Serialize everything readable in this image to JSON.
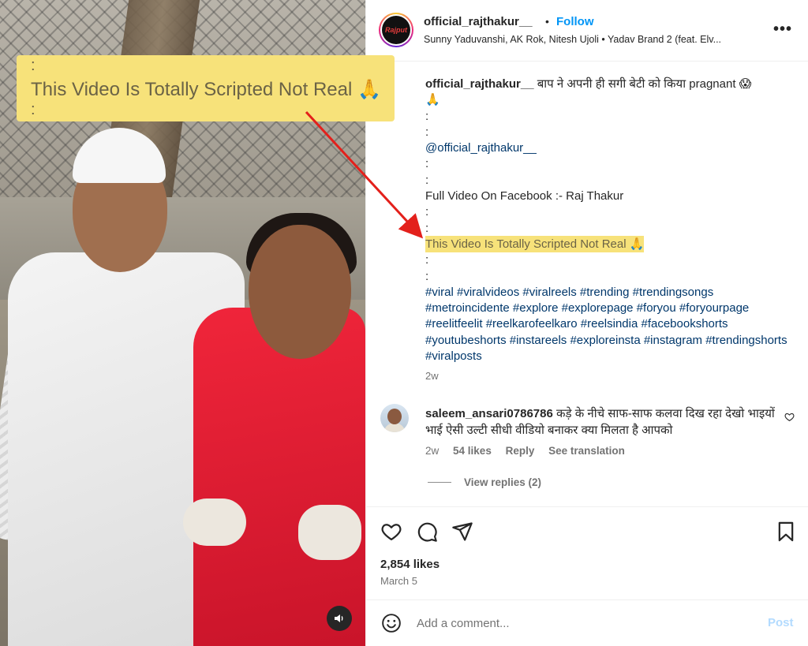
{
  "overlay": {
    "dot_top": ":",
    "text": "This Video Is Totally Scripted Not Real 🙏",
    "dot_bottom": ":"
  },
  "header": {
    "username": "official_rajthakur__",
    "separator": "•",
    "follow_label": "Follow",
    "subtitle": "Sunny Yaduvanshi, AK Rok, Nitesh Ujoli • Yadav Brand 2 (feat. Elv...",
    "avatar_text": "Rajput",
    "more_label": "•••"
  },
  "caption": {
    "username": "official_rajthakur__",
    "title": "बाप ने अपनी ही सगी बेटी को किया pragnant 😱",
    "emoji_line": "🙏",
    "sep1": ":",
    "sep2": ":",
    "mention": "@official_rajthakur__",
    "sep3": ":",
    "sep4": ":",
    "full_video": "Full Video On Facebook :- Raj Thakur",
    "sep5": ":",
    "sep6": ":",
    "disclaimer": "This Video Is Totally Scripted Not Real 🙏",
    "sep7": ":",
    "sep8": ":",
    "hashtags": "#viral #viralvideos #viralreels #trending #trendingsongs #metroincidente #explore #explorepage #foryou #foryourpage #reelitfeelit #reelkarofeelkaro #reelsindia #facebookshorts #youtubeshorts #instareels #exploreinsta #instagram #trendingshorts #viralposts",
    "time": "2w"
  },
  "comment": {
    "username": "saleem_ansari0786786",
    "text": "कड़े के नीचे साफ-साफ कलवा दिख रहा देखो भाइयों भाई ऐसी उल्टी सीधी वीडियो बनाकर क्या मिलता है आपको",
    "time": "2w",
    "likes": "54 likes",
    "reply": "Reply",
    "translation": "See translation",
    "view_replies": "View replies (2)"
  },
  "post": {
    "likes": "2,854 likes",
    "date": "March 5"
  },
  "add_comment": {
    "placeholder": "Add a comment...",
    "post_label": "Post"
  },
  "colors": {
    "follow": "#0095f6",
    "highlight": "#f7e27a",
    "hashtag": "#00376b",
    "post_disabled": "#b3dbff",
    "arrow": "#e3201b"
  },
  "icons": [
    "heart-icon",
    "comment-icon",
    "share-icon",
    "bookmark-icon",
    "emoji-icon",
    "speaker-icon",
    "more-icon",
    "small-heart-icon"
  ]
}
